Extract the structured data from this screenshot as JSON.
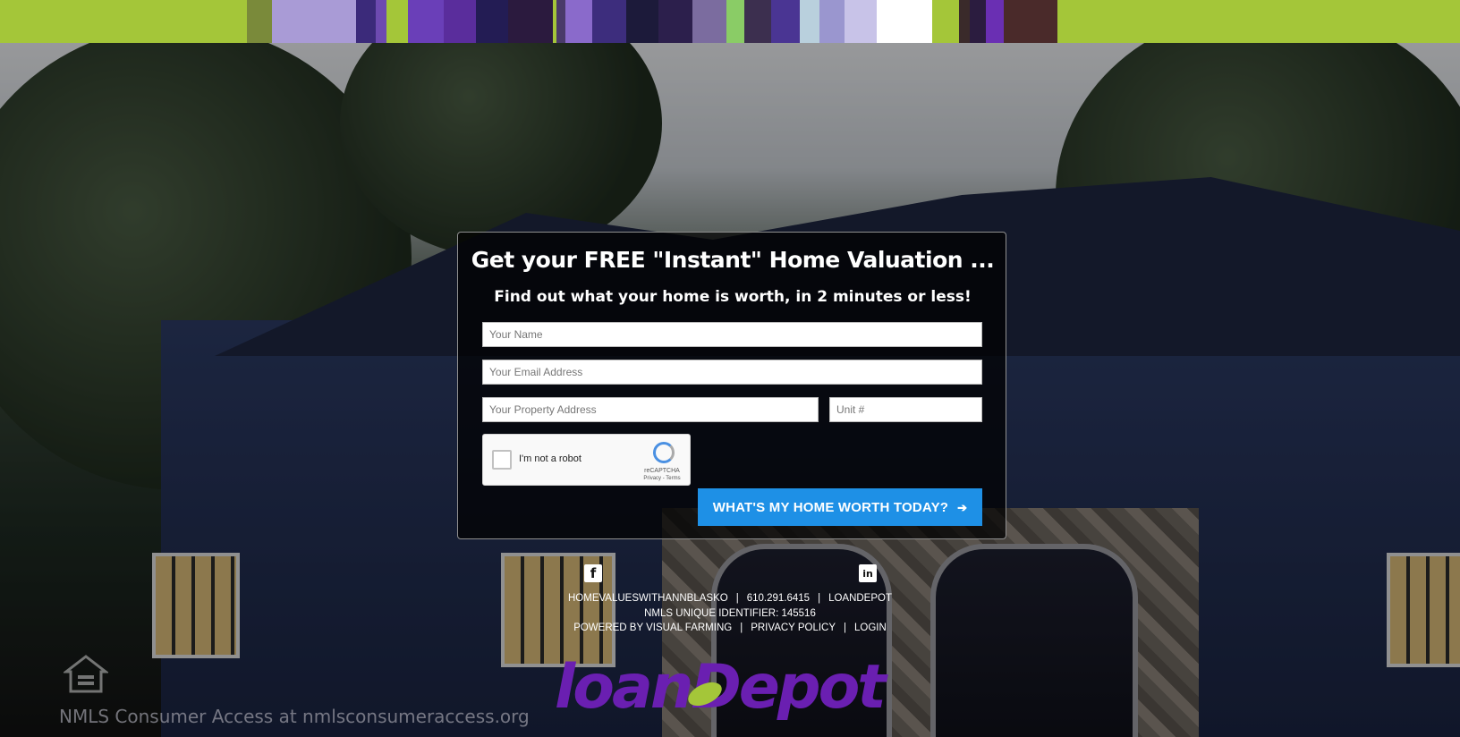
{
  "colors": {
    "accent_green": "#a4c639",
    "button_blue": "#1e90e6",
    "brand_purple": "#6a1fb1"
  },
  "stripes": [
    "#a4c639",
    "#7a8a3a",
    "#a99bd6",
    "#3b2a7a",
    "#6d4ab0",
    "#a4c639",
    "#6a3fb8",
    "#5a2d9c",
    "#231c54",
    "#2b1a3e",
    "#a4c639",
    "#4a3a6a",
    "#8a6acb",
    "#3d2d7d",
    "#1c1a3a",
    "#2c1f4c",
    "#7b6c9f",
    "#8acc66",
    "#3c2f4f",
    "#4a3593",
    "#b9d0dd",
    "#9a96cf",
    "#c8c3e8",
    "#ffffff",
    "#a4c639",
    "#3a2a2a",
    "#2b1c3f",
    "#6a2fb3",
    "#4a2a2a",
    "#a4c639"
  ],
  "form": {
    "title": "Get your FREE \"Instant\" Home Valuation ...",
    "subtitle": "Find out what your home is worth, in 2 minutes or less!",
    "name_placeholder": "Your Name",
    "email_placeholder": "Your Email Address",
    "address_placeholder": "Your Property Address",
    "unit_placeholder": "Unit #",
    "captcha_label": "I'm not a robot",
    "captcha_brand": "reCAPTCHA",
    "captcha_links": "Privacy - Terms",
    "submit_label": "WHAT'S MY HOME WORTH TODAY?",
    "submit_icon": "arrow-right-icon"
  },
  "social": {
    "facebook_glyph": "f",
    "linkedin_glyph": "in"
  },
  "footer": {
    "site": "HOMEVALUESWITHANNBLASKO",
    "phone": "610.291.6415",
    "company": "LOANDEPOT",
    "nmls": "NMLS UNIQUE IDENTIFIER: 145516",
    "powered": "POWERED BY VISUAL FARMING",
    "privacy": "PRIVACY POLICY",
    "login": "LOGIN",
    "separator": "|"
  },
  "nmls_consumer": "NMLS Consumer Access at nmlsconsumeraccess.org",
  "brand": {
    "logo_part1": "loan",
    "logo_part2": "Depot"
  }
}
